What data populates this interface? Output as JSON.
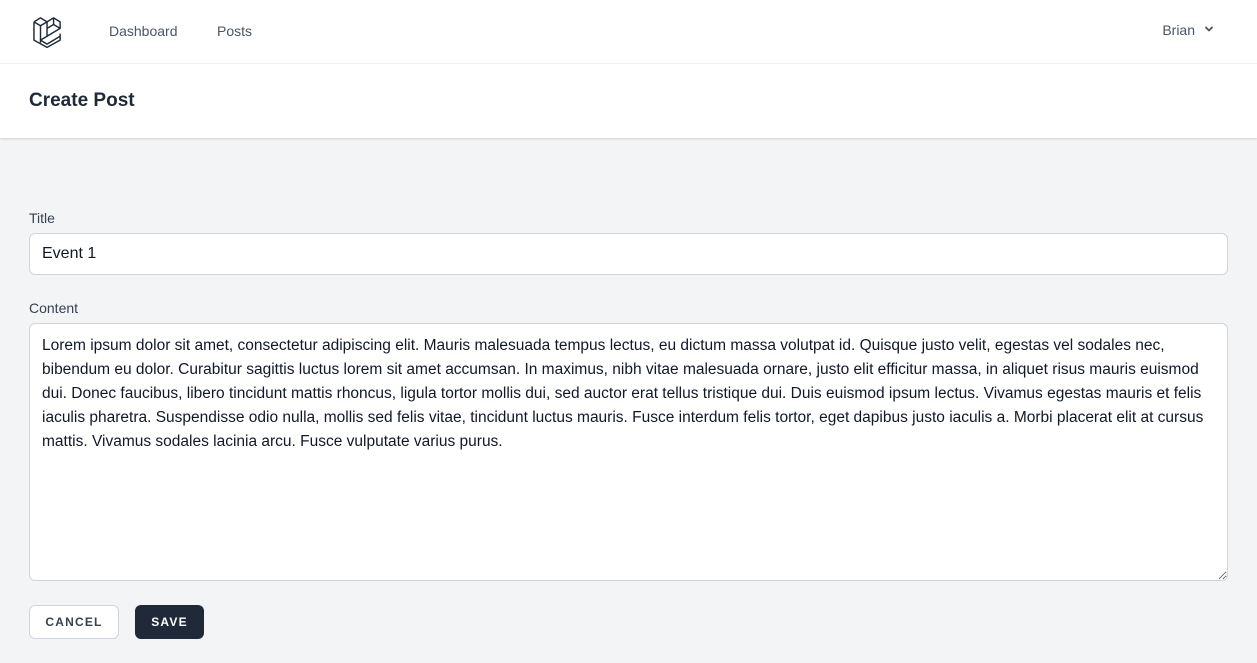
{
  "nav": {
    "links": [
      "Dashboard",
      "Posts"
    ],
    "user": {
      "name": "Brian"
    }
  },
  "header": {
    "title": "Create Post"
  },
  "form": {
    "title_label": "Title",
    "title_value": "Event 1",
    "content_label": "Content",
    "content_value": "Lorem ipsum dolor sit amet, consectetur adipiscing elit. Mauris malesuada tempus lectus, eu dictum massa volutpat id. Quisque justo velit, egestas vel sodales nec, bibendum eu dolor. Curabitur sagittis luctus lorem sit amet accumsan. In maximus, nibh vitae malesuada ornare, justo elit efficitur massa, in aliquet risus mauris euismod dui. Donec faucibus, libero tincidunt mattis rhoncus, ligula tortor mollis dui, sed auctor erat tellus tristique dui. Duis euismod ipsum lectus. Vivamus egestas mauris et felis iaculis pharetra. Suspendisse odio nulla, mollis sed felis vitae, tincidunt luctus mauris. Fusce interdum felis tortor, eget dapibus justo iaculis a. Morbi placerat elit at cursus mattis. Vivamus sodales lacinia arcu. Fusce vulputate varius purus.",
    "cancel_label": "CANCEL",
    "save_label": "SAVE"
  },
  "colors": {
    "background": "#f3f4f6",
    "surface": "#ffffff",
    "primary_button": "#1f2937",
    "border": "#d1d5db"
  },
  "icons": {
    "logo": "laravel-logo-icon",
    "user_menu": "chevron-down-icon"
  }
}
